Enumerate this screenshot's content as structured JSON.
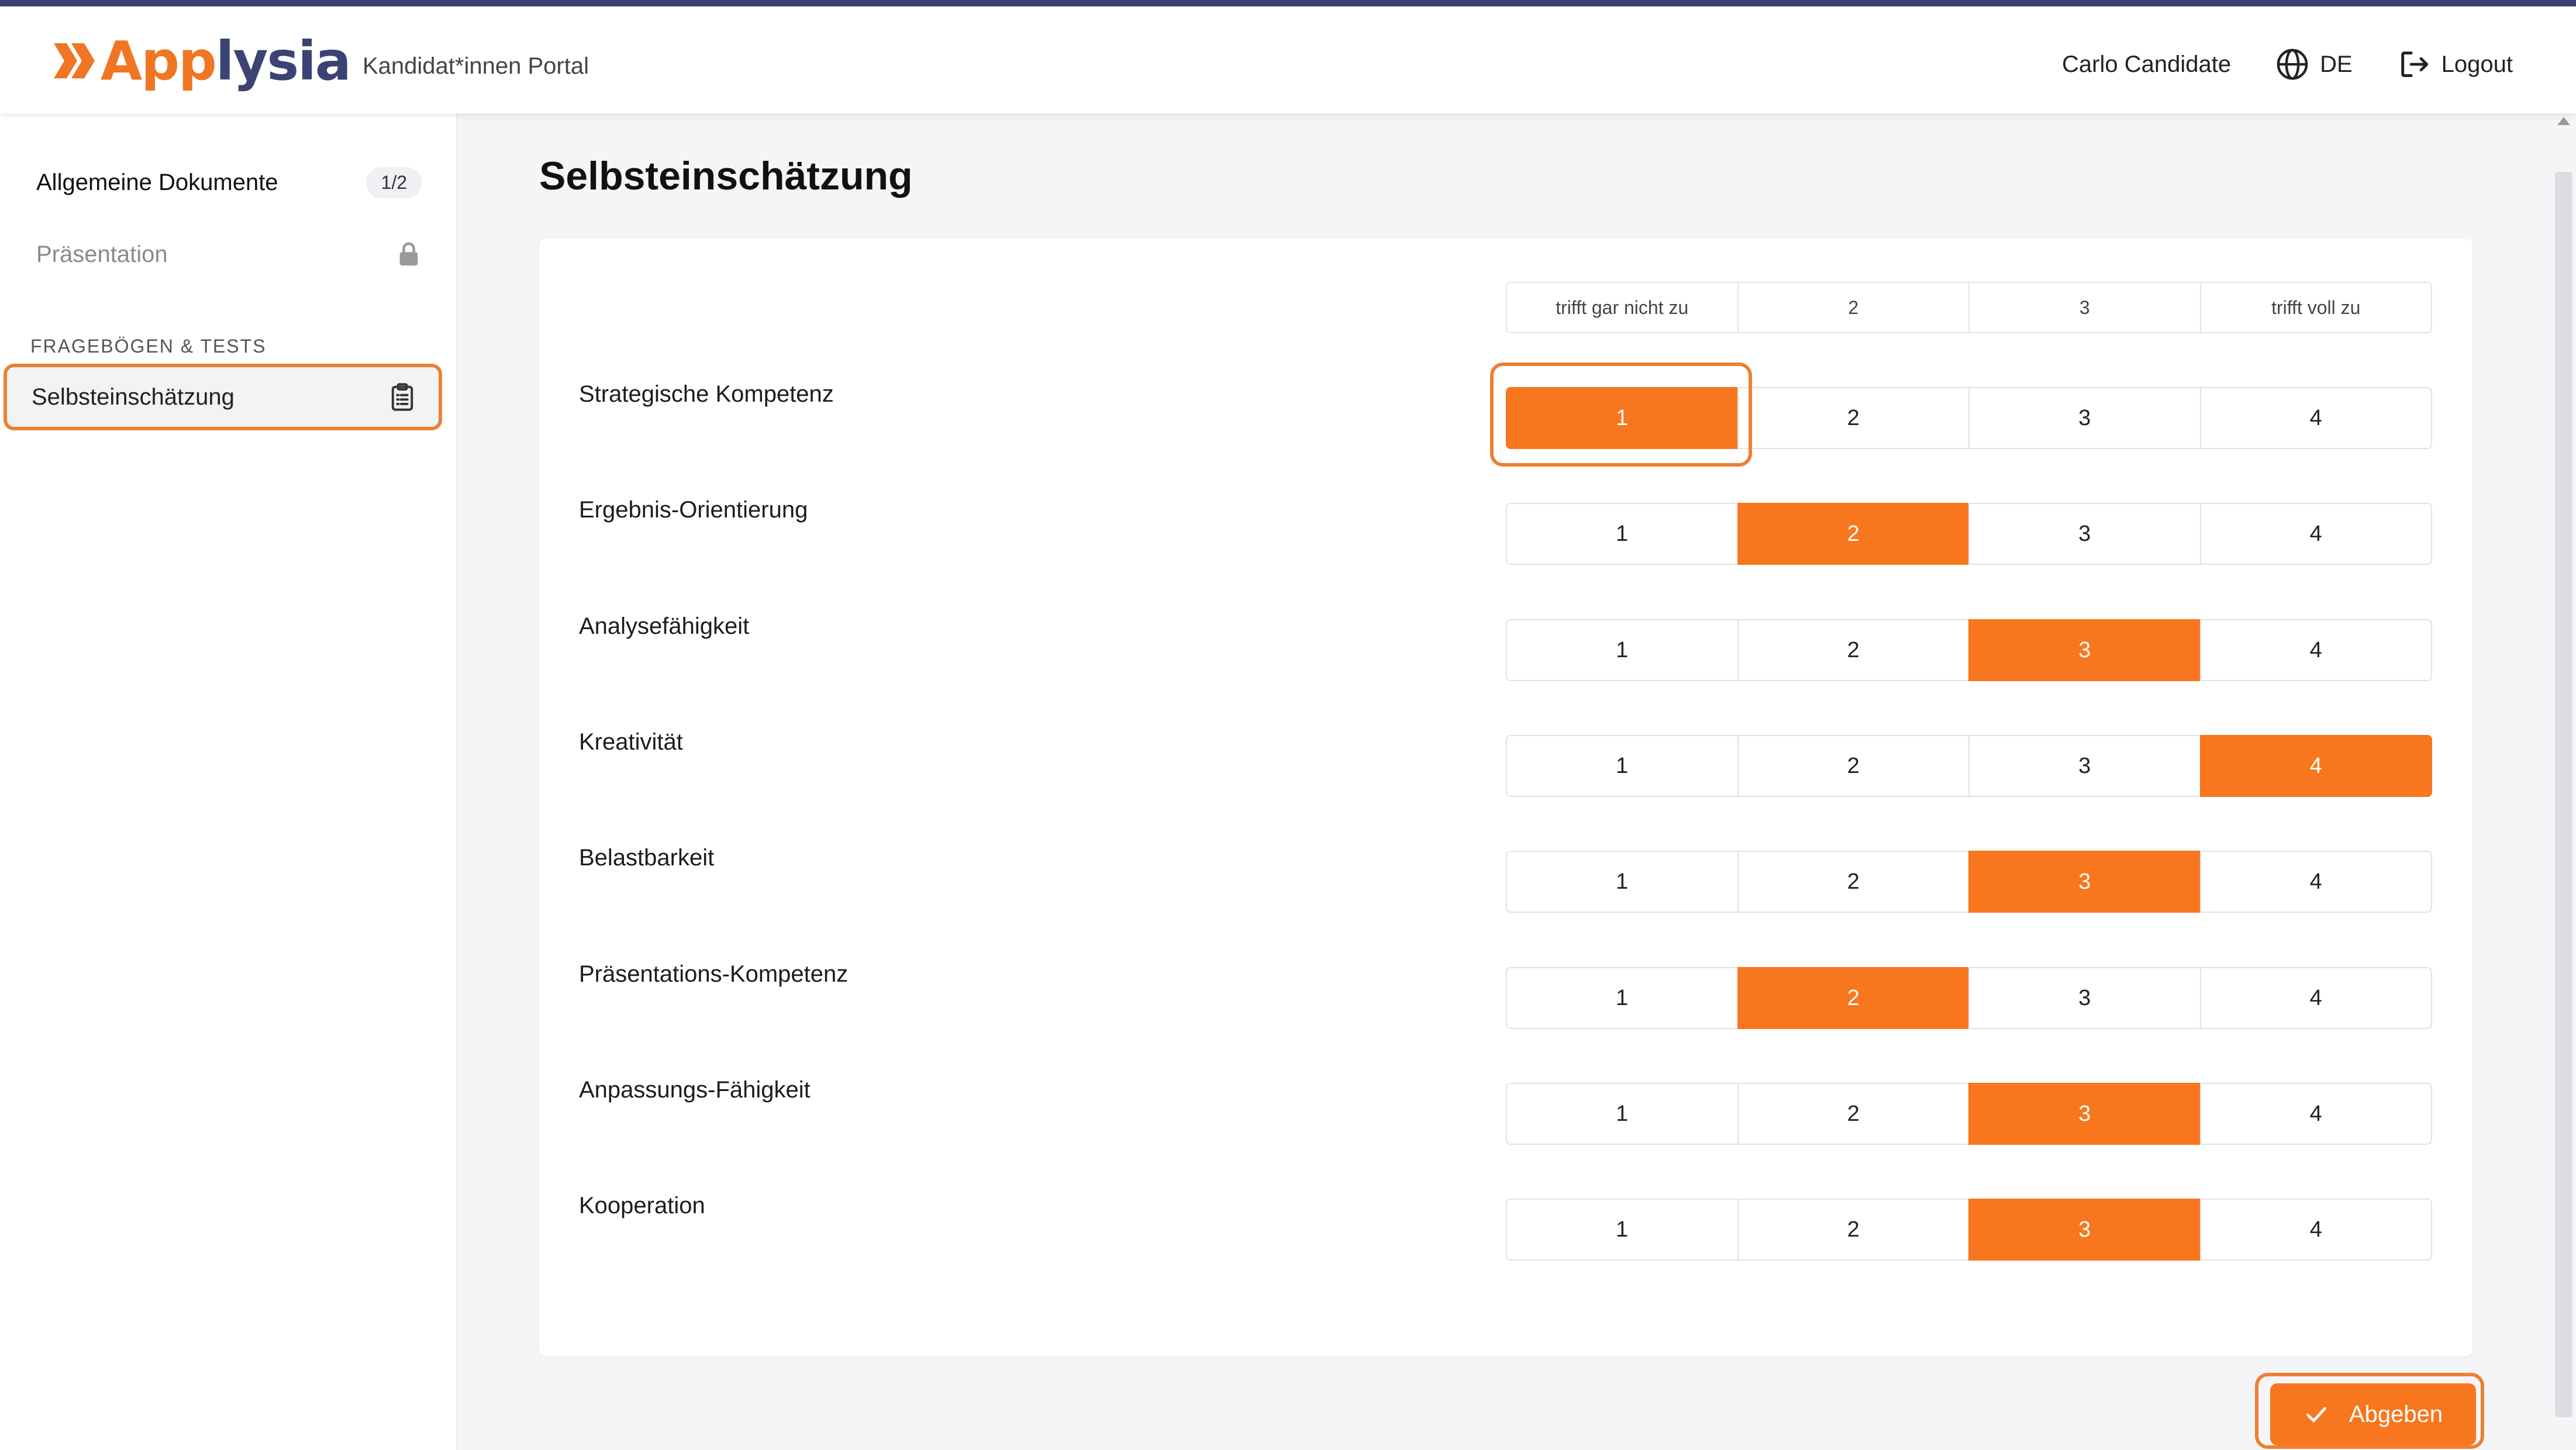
{
  "header": {
    "logo_part1": "App",
    "logo_part2": "lysia",
    "portal": "Kandidat*innen Portal",
    "user": "Carlo Candidate",
    "language": "DE",
    "logout": "Logout"
  },
  "sidebar": {
    "items": [
      {
        "label": "Allgemeine Dokumente",
        "badge": "1/2"
      },
      {
        "label": "Präsentation",
        "icon": "lock-icon"
      }
    ],
    "section": "FRAGEBÖGEN & TESTS",
    "active": {
      "label": "Selbsteinschätzung",
      "icon": "clipboard-icon"
    }
  },
  "main": {
    "title": "Selbsteinschätzung",
    "scale_headers": [
      "trifft gar nicht zu",
      "2",
      "3",
      "trifft voll zu"
    ],
    "options": [
      "1",
      "2",
      "3",
      "4"
    ],
    "rows": [
      {
        "label": "Strategische Kompetenz",
        "selected": 1
      },
      {
        "label": "Ergebnis-Orientierung",
        "selected": 2
      },
      {
        "label": "Analysefähigkeit",
        "selected": 3
      },
      {
        "label": "Kreativität",
        "selected": 4
      },
      {
        "label": "Belastbarkeit",
        "selected": 3
      },
      {
        "label": "Präsentations-Kompetenz",
        "selected": 2
      },
      {
        "label": "Anpassungs-Fähigkeit",
        "selected": 3
      },
      {
        "label": "Kooperation",
        "selected": 3
      }
    ],
    "submit": "Abgeben"
  },
  "colors": {
    "accent": "#f8761d",
    "brand": "#3b4374"
  }
}
